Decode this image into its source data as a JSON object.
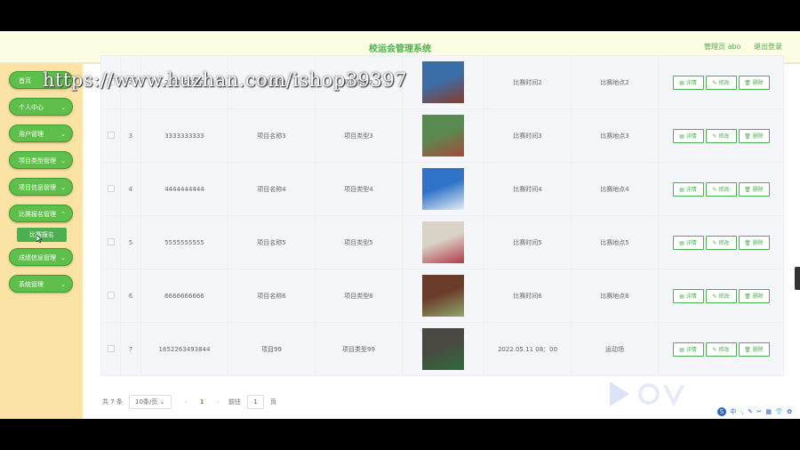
{
  "header": {
    "title": "校运会管理系统",
    "user": "管理员 abo",
    "logout": "退出登录"
  },
  "watermark": "https://www.huzhan.com/ishop39397",
  "sidebar": {
    "items": [
      {
        "label": "首页"
      },
      {
        "label": "个人中心"
      },
      {
        "label": "用户管理"
      },
      {
        "label": "项目类型管理"
      },
      {
        "label": "项目信息管理"
      },
      {
        "label": "比赛报名管理"
      },
      {
        "label": "成绩信息管理"
      },
      {
        "label": "系统管理"
      }
    ],
    "sub_item": "比赛报名"
  },
  "table": {
    "actions": {
      "detail": "详情",
      "edit": "修改",
      "delete": "删除"
    },
    "rows": [
      {
        "index": "2",
        "account": "2222222222",
        "project": "项目名称2",
        "type": "项目类型2",
        "time": "比赛时间2",
        "place": "比赛地点2"
      },
      {
        "index": "3",
        "account": "3333333333",
        "project": "项目名称3",
        "type": "项目类型3",
        "time": "比赛时间3",
        "place": "比赛地点3"
      },
      {
        "index": "4",
        "account": "4444444444",
        "project": "项目名称4",
        "type": "项目类型4",
        "time": "比赛时间4",
        "place": "比赛地点4"
      },
      {
        "index": "5",
        "account": "5555555555",
        "project": "项目名称5",
        "type": "项目类型5",
        "time": "比赛时间5",
        "place": "比赛地点5"
      },
      {
        "index": "6",
        "account": "6666666666",
        "project": "项目名称6",
        "type": "项目类型6",
        "time": "比赛时间6",
        "place": "比赛地点6"
      },
      {
        "index": "7",
        "account": "1652263493844",
        "project": "项目99",
        "type": "项目类型99",
        "time": "2022.05.11 08：00",
        "place": "运动场"
      }
    ]
  },
  "pagination": {
    "total": "共 7 条",
    "page_size": "10条/页",
    "current": "1",
    "goto_label": "前往",
    "goto_value": "1",
    "page_suffix": "页"
  },
  "tray": {
    "items": [
      "中",
      "·,",
      "✎",
      "✂",
      "▦",
      "👕",
      "✿"
    ]
  }
}
